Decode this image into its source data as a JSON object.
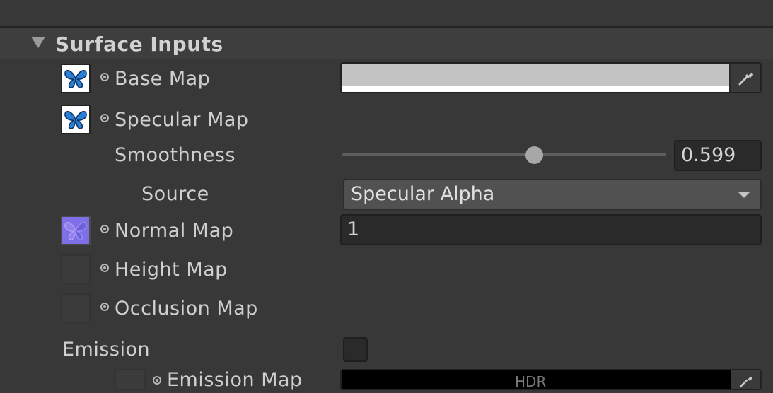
{
  "section": {
    "title": "Surface Inputs"
  },
  "rows": {
    "base_map": {
      "label": "Base Map"
    },
    "specular_map": {
      "label": "Specular Map"
    },
    "smoothness": {
      "label": "Smoothness",
      "value": "0.599",
      "slider_level": 0.599
    },
    "source": {
      "label": "Source",
      "selected": "Specular Alpha"
    },
    "normal_map": {
      "label": "Normal Map",
      "value": "1"
    },
    "height_map": {
      "label": "Height Map"
    },
    "occlusion_map": {
      "label": "Occlusion Map"
    },
    "emission": {
      "label": "Emission",
      "checked": false
    },
    "emission_map": {
      "label": "Emission Map",
      "hdr_text": "HDR"
    }
  },
  "colors": {
    "background": "#383838",
    "base_map_tint": "#c4c4c4",
    "normal_map_thumb": "#7d6fe6",
    "butterfly_blue": "#2a7fd6"
  },
  "icons": {
    "foldout": "triangle-down-icon",
    "texture_dot": "object-picker-icon",
    "eyedropper": "eyedropper-icon",
    "dropdown": "chevron-down-icon"
  }
}
